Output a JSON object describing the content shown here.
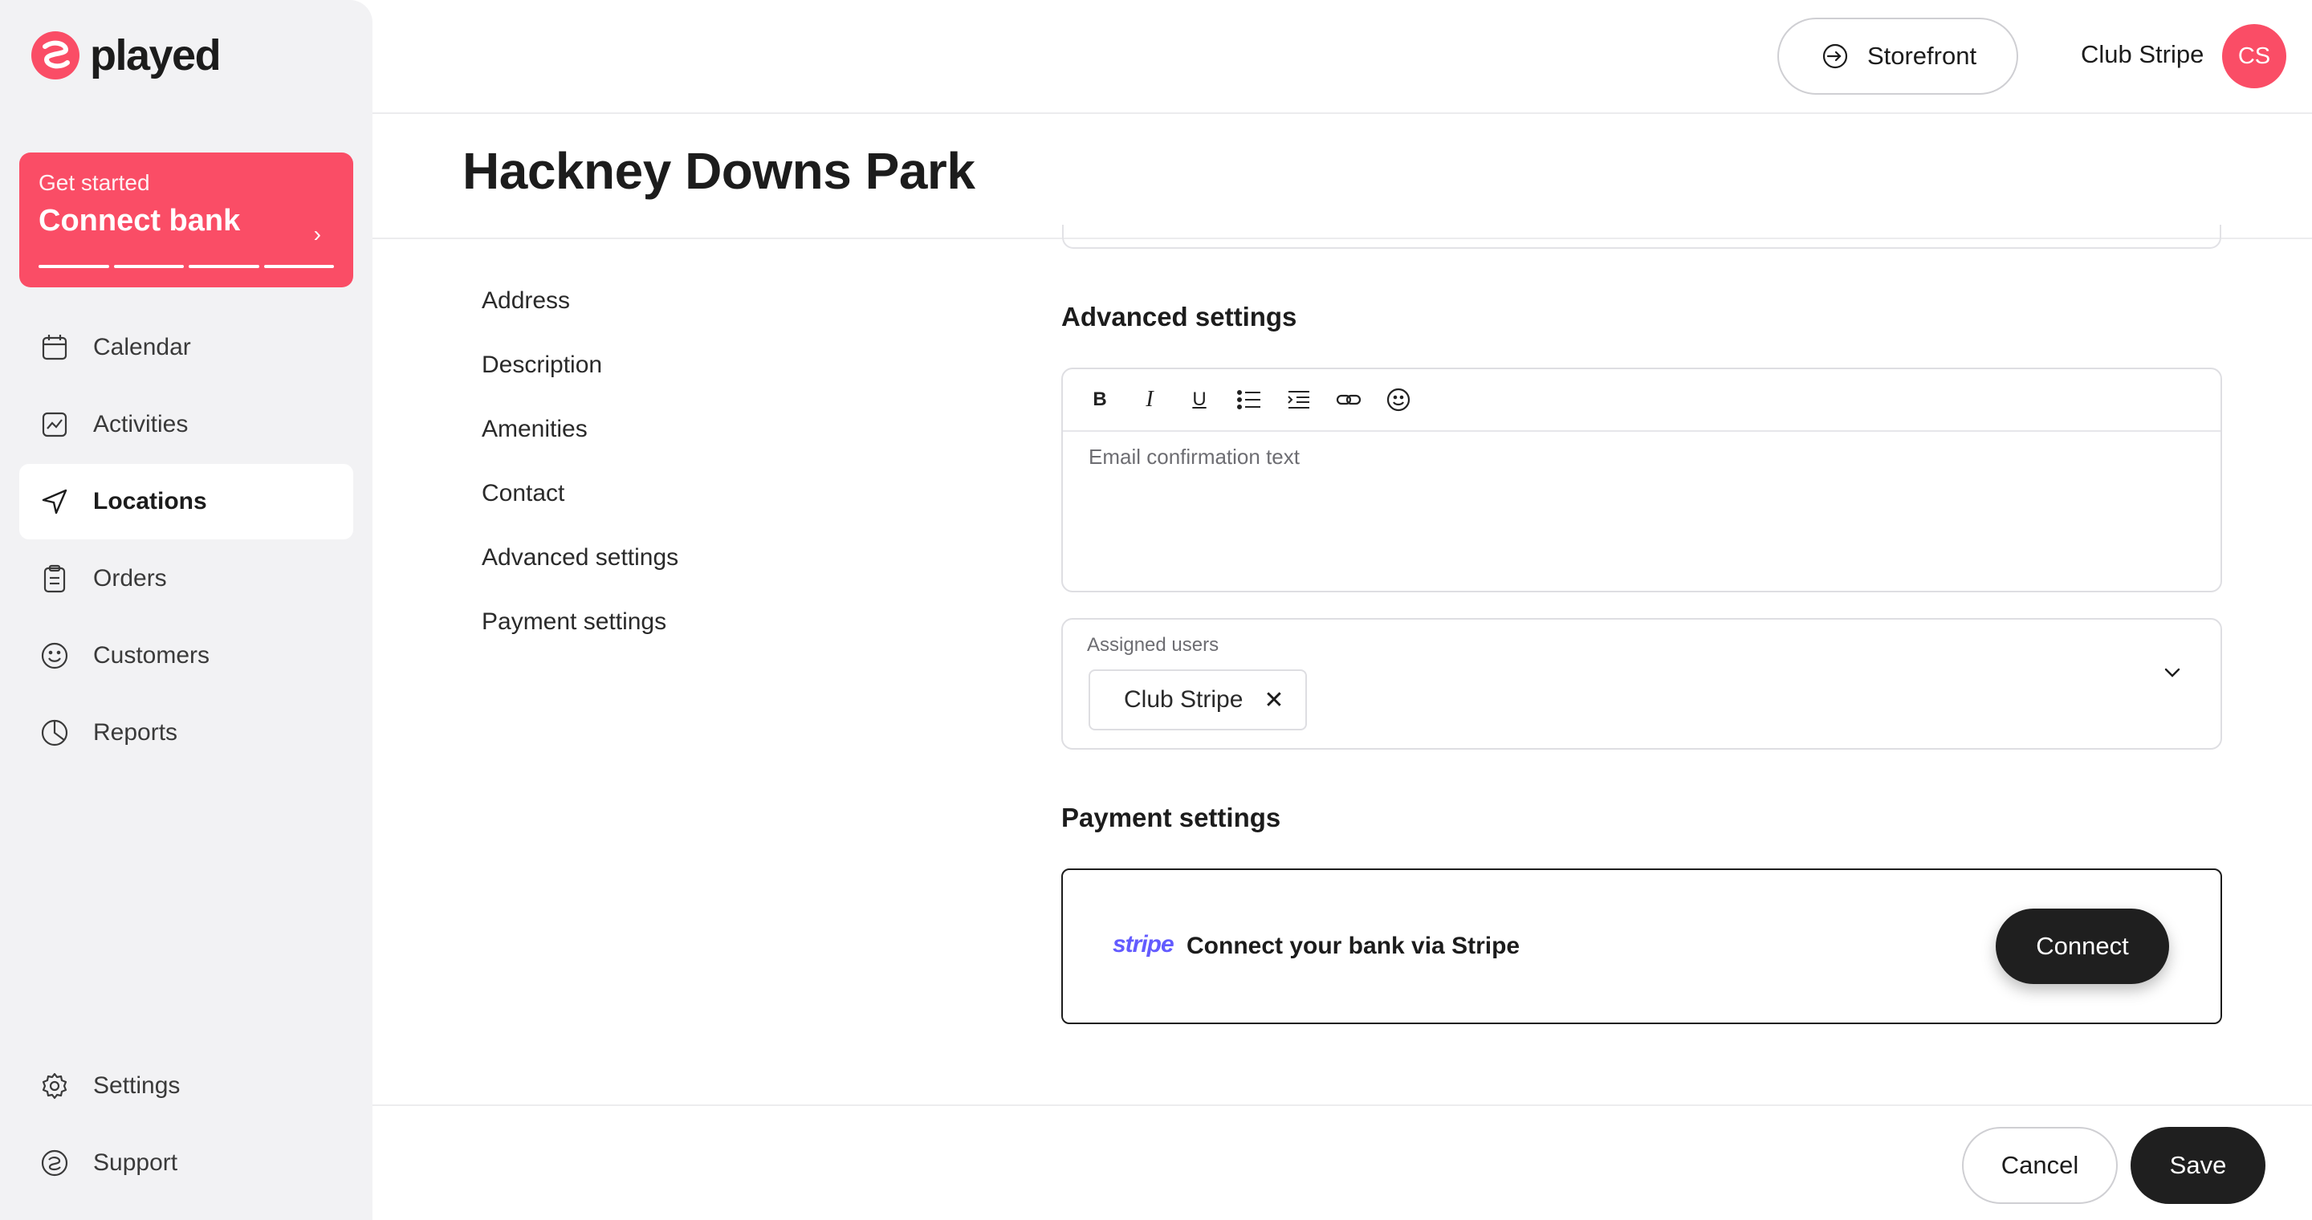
{
  "brand": {
    "name": "played",
    "color": "#fa4d66"
  },
  "onboarding": {
    "subtitle": "Get started",
    "title": "Connect bank",
    "steps_total": 4
  },
  "sidebar": {
    "items": [
      {
        "label": "Calendar",
        "icon": "calendar-icon"
      },
      {
        "label": "Activities",
        "icon": "activity-chart-icon"
      },
      {
        "label": "Locations",
        "icon": "location-arrow-icon",
        "active": true
      },
      {
        "label": "Orders",
        "icon": "clipboard-icon"
      },
      {
        "label": "Customers",
        "icon": "smiley-icon"
      },
      {
        "label": "Reports",
        "icon": "pie-chart-icon"
      }
    ],
    "bottom_items": [
      {
        "label": "Settings",
        "icon": "gear-icon"
      },
      {
        "label": "Support",
        "icon": "support-icon"
      }
    ]
  },
  "header": {
    "storefront_label": "Storefront",
    "account_name": "Club Stripe",
    "avatar_initials": "CS"
  },
  "page": {
    "title": "Hackney Downs Park"
  },
  "section_nav": [
    "Address",
    "Description",
    "Amenities",
    "Contact",
    "Advanced settings",
    "Payment settings"
  ],
  "advanced": {
    "heading": "Advanced settings",
    "editor_placeholder": "Email confirmation text",
    "toolbar": [
      "bold",
      "italic",
      "underline",
      "bullet-list",
      "indent",
      "link",
      "emoji"
    ],
    "assigned_users_label": "Assigned users",
    "assigned_users": [
      "Club Stripe"
    ]
  },
  "payment": {
    "heading": "Payment settings",
    "stripe_logo": "stripe",
    "connect_text": "Connect your bank via Stripe",
    "connect_button": "Connect"
  },
  "footer": {
    "cancel_label": "Cancel",
    "save_label": "Save"
  }
}
